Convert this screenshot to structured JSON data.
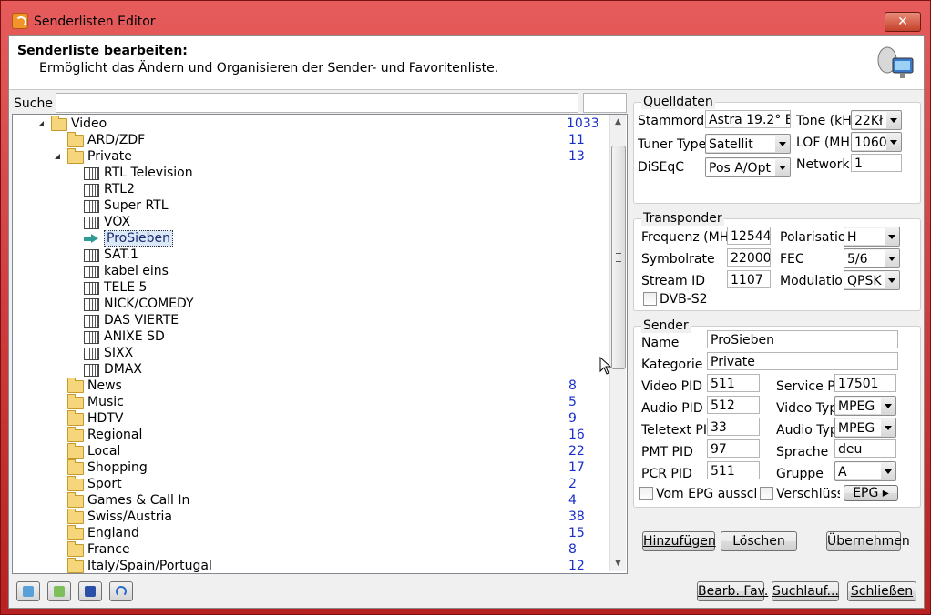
{
  "window": {
    "title": "Senderlisten Editor",
    "close": "✕"
  },
  "header": {
    "title": "Senderliste bearbeiten:",
    "subtitle": "Ermöglicht das Ändern und Organisieren der Sender- und Favoritenliste."
  },
  "search": {
    "label": "Suche",
    "value": ""
  },
  "tree": {
    "rows": [
      {
        "label": "Video",
        "count": "1033",
        "level": 0,
        "icon": "folder-icon",
        "exp": "open"
      },
      {
        "label": "ARD/ZDF",
        "count": "11",
        "level": 1,
        "icon": "folder-icon",
        "exp": "closed"
      },
      {
        "label": "Private",
        "count": "13",
        "level": 1,
        "icon": "folder-icon",
        "exp": "open"
      },
      {
        "label": "RTL Television",
        "count": "",
        "level": 2,
        "icon": "channel-icon",
        "exp": "closed"
      },
      {
        "label": "RTL2",
        "count": "",
        "level": 2,
        "icon": "channel-icon",
        "exp": ""
      },
      {
        "label": "Super RTL",
        "count": "",
        "level": 2,
        "icon": "channel-icon",
        "exp": ""
      },
      {
        "label": "VOX",
        "count": "",
        "level": 2,
        "icon": "channel-icon",
        "exp": ""
      },
      {
        "label": "ProSieben",
        "count": "",
        "level": 2,
        "icon": "selected-arrow-icon",
        "exp": "closed",
        "selected": true
      },
      {
        "label": "SAT.1",
        "count": "",
        "level": 2,
        "icon": "channel-icon",
        "exp": "closed"
      },
      {
        "label": "kabel eins",
        "count": "",
        "level": 2,
        "icon": "channel-icon",
        "exp": ""
      },
      {
        "label": "TELE 5",
        "count": "",
        "level": 2,
        "icon": "channel-icon",
        "exp": ""
      },
      {
        "label": "NICK/COMEDY",
        "count": "",
        "level": 2,
        "icon": "channel-icon",
        "exp": ""
      },
      {
        "label": "DAS VIERTE",
        "count": "",
        "level": 2,
        "icon": "channel-icon",
        "exp": "closed"
      },
      {
        "label": "ANIXE SD",
        "count": "",
        "level": 2,
        "icon": "channel-icon",
        "exp": ""
      },
      {
        "label": "SIXX",
        "count": "",
        "level": 2,
        "icon": "channel-icon",
        "exp": ""
      },
      {
        "label": "DMAX",
        "count": "",
        "level": 2,
        "icon": "channel-icon",
        "exp": ""
      },
      {
        "label": "News",
        "count": "8",
        "level": 1,
        "icon": "folder-icon",
        "exp": "closed"
      },
      {
        "label": "Music",
        "count": "5",
        "level": 1,
        "icon": "folder-icon",
        "exp": "closed"
      },
      {
        "label": "HDTV",
        "count": "9",
        "level": 1,
        "icon": "folder-icon",
        "exp": "closed"
      },
      {
        "label": "Regional",
        "count": "16",
        "level": 1,
        "icon": "folder-icon",
        "exp": "closed"
      },
      {
        "label": "Local",
        "count": "22",
        "level": 1,
        "icon": "folder-icon",
        "exp": "closed"
      },
      {
        "label": "Shopping",
        "count": "17",
        "level": 1,
        "icon": "folder-icon",
        "exp": "closed"
      },
      {
        "label": "Sport",
        "count": "2",
        "level": 1,
        "icon": "folder-icon",
        "exp": "closed"
      },
      {
        "label": "Games & Call In",
        "count": "4",
        "level": 1,
        "icon": "folder-icon",
        "exp": "closed"
      },
      {
        "label": "Swiss/Austria",
        "count": "38",
        "level": 1,
        "icon": "folder-icon",
        "exp": "closed"
      },
      {
        "label": "England",
        "count": "15",
        "level": 1,
        "icon": "folder-icon",
        "exp": "closed"
      },
      {
        "label": "France",
        "count": "8",
        "level": 1,
        "icon": "folder-icon",
        "exp": "closed"
      },
      {
        "label": "Italy/Spain/Portugal",
        "count": "12",
        "level": 1,
        "icon": "folder-icon",
        "exp": "closed"
      }
    ]
  },
  "quelldaten": {
    "title": "Quelldaten",
    "stammordner_label": "Stammordı",
    "stammordner_value": "Astra 19.2° E",
    "tuner_label": "Tuner Type",
    "tuner_value": "Satellit",
    "diseqc_label": "DiSEqC",
    "diseqc_value": "Pos A/Opt",
    "tone_label": "Tone (kH",
    "tone_value": "22Kł",
    "lof_label": "LOF  (MH",
    "lof_value": "1060",
    "network_label": "Network",
    "network_value": "1"
  },
  "transponder": {
    "title": "Transponder",
    "freq_label": "Frequenz (MH",
    "freq_value": "12544",
    "symbol_label": "Symbolrate",
    "symbol_value": "22000",
    "stream_label": "Stream ID",
    "stream_value": "1107",
    "dvbs2_label": "DVB-S2",
    "pol_label": "Polarisatio",
    "pol_value": "H",
    "fec_label": "FEC",
    "fec_value": "5/6",
    "mod_label": "Modulatio",
    "mod_value": "QPSK"
  },
  "sender": {
    "title": "Sender",
    "name_label": "Name",
    "name_value": "ProSieben",
    "kat_label": "Kategorie",
    "kat_value": "Private",
    "vpid_label": "Video PID",
    "vpid_value": "511",
    "apid_label": "Audio PID",
    "apid_value": "512",
    "tpid_label": "Teletext PII",
    "tpid_value": "33",
    "pmt_label": "PMT PID",
    "pmt_value": "97",
    "pcr_label": "PCR PID",
    "pcr_value": "511",
    "spid_label": "Service PI",
    "spid_value": "17501",
    "vtyp_label": "Video Typ",
    "vtyp_value": "MPEG",
    "atyp_label": "Audio Typ",
    "atyp_value": "MPEG",
    "sprache_label": "Sprache",
    "sprache_value": "deu",
    "gruppe_label": "Gruppe",
    "gruppe_value": "A",
    "epg_excl_label": "Vom EPG aussch",
    "encrypted_label": "Verschlüss",
    "epg_button": "EPG"
  },
  "actions": {
    "add": "Hinzufügen",
    "delete": "Löschen",
    "apply": "Übernehmen"
  },
  "footer": {
    "edit_fav": "Bearb. Fav.",
    "scan": "Suchlauf...",
    "close": "Schließen"
  },
  "colors": {
    "accent": "#2f9b93",
    "count": "#1a2ecc",
    "window": "#c62b2b"
  }
}
